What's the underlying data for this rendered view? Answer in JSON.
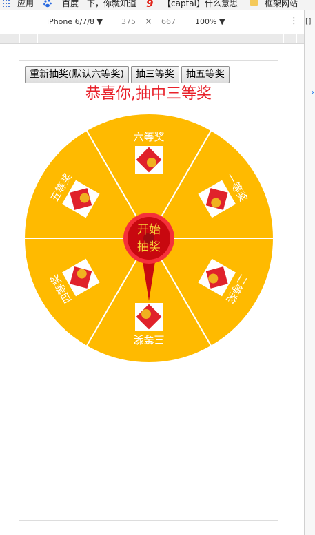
{
  "bookmarks": {
    "items": [
      "应用",
      "百度一下，你就知道",
      "【captai】什么意思",
      "框架网站"
    ]
  },
  "devtools": {
    "device": "iPhone 6/7/8 ▼",
    "width": "375",
    "times": "×",
    "height": "667",
    "zoom": "100% ▼",
    "more": "⋮",
    "dock": "[]",
    "chevron": "›"
  },
  "page": {
    "buttons": [
      "重新抽奖(默认六等奖)",
      "抽三等奖",
      "抽五等奖"
    ],
    "result": "恭喜你,抽中三等奖",
    "start_line1": "开始",
    "start_line2": "抽奖"
  },
  "wheel": {
    "prizes": [
      "六等奖",
      "一等奖",
      "二等奖",
      "三等奖",
      "四等奖",
      "五等奖"
    ],
    "colors": {
      "sector": "#FFBA00",
      "divider": "#ffffff",
      "label": "#ffffff",
      "button": "#c8080f",
      "button_ring": "#f5303a",
      "button_text": "#f7d23a",
      "prize_box": "#ffffff",
      "prize_red": "#e0222b",
      "prize_gold": "#f0b020"
    }
  }
}
